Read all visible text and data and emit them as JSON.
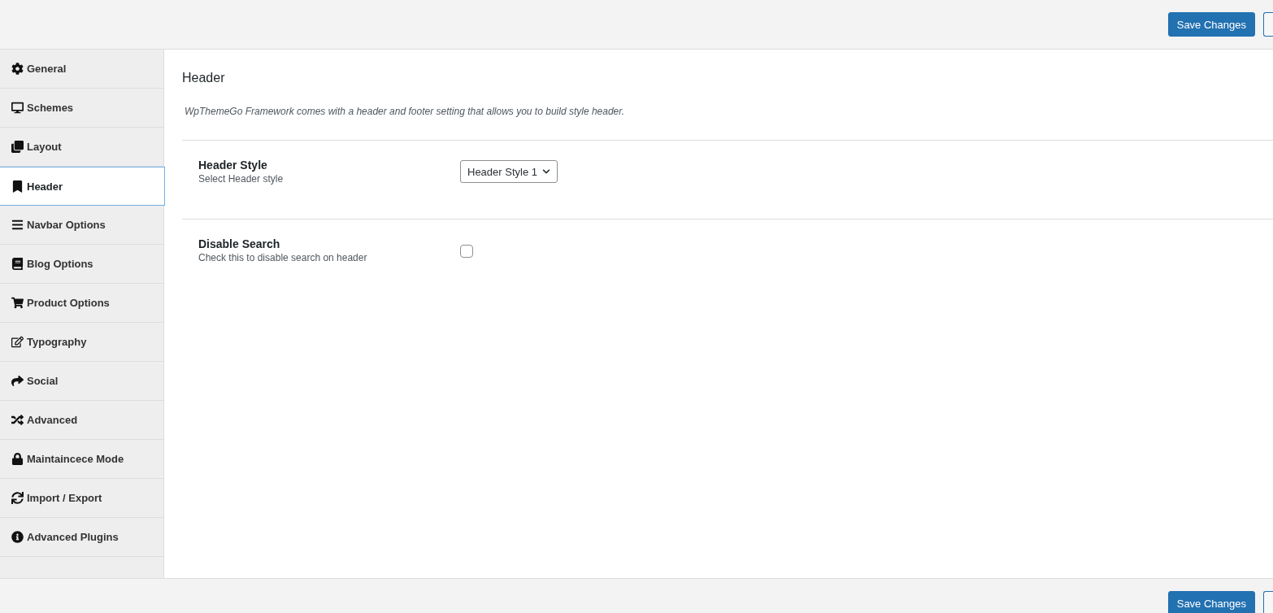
{
  "toolbar": {
    "save_button": "Save Changes"
  },
  "sidebar": {
    "items": [
      {
        "label": "General",
        "selected": false
      },
      {
        "label": "Schemes",
        "selected": false
      },
      {
        "label": "Layout",
        "selected": false
      },
      {
        "label": "Header",
        "selected": true
      },
      {
        "label": "Navbar Options",
        "selected": false
      },
      {
        "label": "Blog Options",
        "selected": false
      },
      {
        "label": "Product Options",
        "selected": false
      },
      {
        "label": "Typography",
        "selected": false
      },
      {
        "label": "Social",
        "selected": false
      },
      {
        "label": "Advanced",
        "selected": false
      },
      {
        "label": "Maintaincece Mode",
        "selected": false
      },
      {
        "label": "Import / Export",
        "selected": false
      },
      {
        "label": "Advanced Plugins",
        "selected": false
      }
    ]
  },
  "section": {
    "title": "Header",
    "description": "WpThemeGo Framework comes with a header and footer setting that allows you to build style header."
  },
  "fields": [
    {
      "kind": "select",
      "label": "Header Style",
      "help": "Select Header style",
      "value": "Header Style 1"
    },
    {
      "kind": "checkbox",
      "label": "Disable Search",
      "help": "Check this to disable search on header",
      "checked": false
    }
  ],
  "footer": {
    "save_button": "Save Changes"
  }
}
